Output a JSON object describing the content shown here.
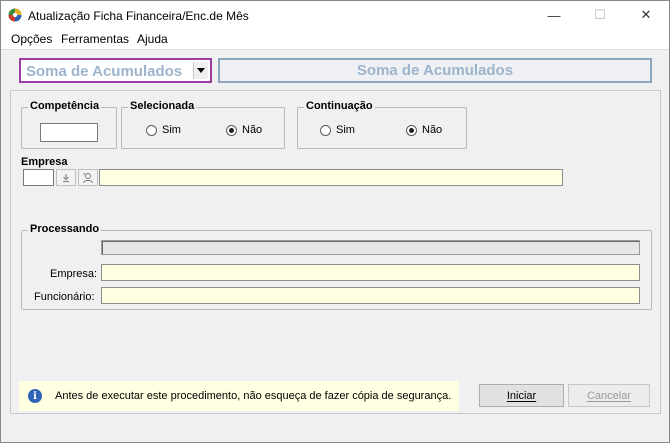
{
  "window": {
    "title": "Atualização Ficha Financeira/Enc.de Mês",
    "minimize_glyph": "—",
    "maximize_glyph": "☐",
    "close_glyph": "✕"
  },
  "menu": {
    "items": [
      {
        "label": "Opções"
      },
      {
        "label": "Ferramentas"
      },
      {
        "label": "Ajuda"
      }
    ]
  },
  "header": {
    "combo_value": "Soma de Acumulados",
    "banner_text": "Soma de Acumulados",
    "accent_color": "#9b3fa6",
    "banner_text_color": "#9cb4cc"
  },
  "form": {
    "competencia": {
      "label": "Competência",
      "value": ""
    },
    "selecionada": {
      "label": "Selecionada",
      "options": [
        {
          "label": "Sim",
          "checked": false
        },
        {
          "label": "Não",
          "checked": true
        }
      ]
    },
    "continuacao": {
      "label": "Continuação",
      "options": [
        {
          "label": "Sim",
          "checked": false
        },
        {
          "label": "Não",
          "checked": true
        }
      ]
    },
    "empresa": {
      "label": "Empresa",
      "code": "",
      "name": ""
    }
  },
  "processando": {
    "label": "Processando",
    "progress": 0,
    "empresa_label": "Empresa:",
    "empresa_value": "",
    "funcionario_label": "Funcionário:",
    "funcionario_value": ""
  },
  "footer": {
    "info_icon": "info-icon",
    "info_glyph": "i",
    "info_text": "Antes de executar este procedimento, não esqueça de fazer cópia de segurança.",
    "iniciar_label": "Iniciar",
    "cancelar_label": "Cancelar"
  }
}
